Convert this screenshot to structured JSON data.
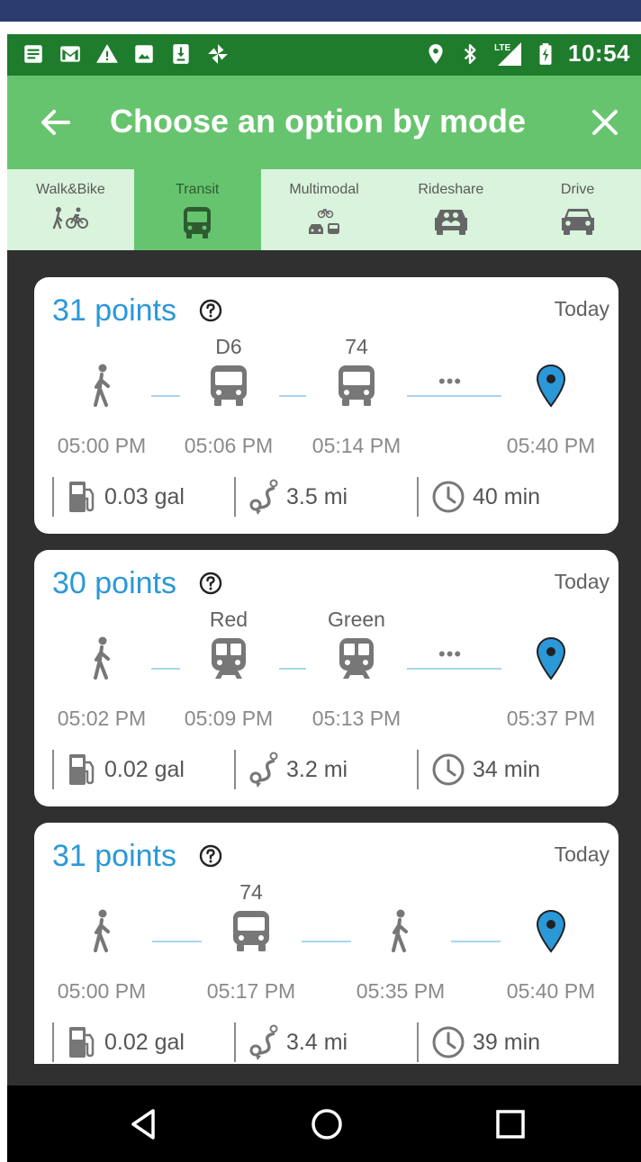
{
  "status_bar": {
    "time": "10:54",
    "left_icons": [
      "notes-icon",
      "gmail-icon",
      "warning-icon",
      "image-icon",
      "download-icon",
      "pinwheel-icon"
    ],
    "right_icons": [
      "location-icon",
      "bluetooth-icon",
      "lte-signal-icon",
      "battery-charging-icon"
    ],
    "lte_label": "LTE"
  },
  "app_bar": {
    "title": "Choose an option by mode",
    "back_icon": "arrow-back-icon",
    "close_icon": "close-icon"
  },
  "mode_tabs": [
    {
      "label": "Walk&Bike",
      "icon": "walk-bike-icon",
      "active": false
    },
    {
      "label": "Transit",
      "icon": "bus-icon",
      "active": true
    },
    {
      "label": "Multimodal",
      "icon": "multimodal-icon",
      "active": false
    },
    {
      "label": "Rideshare",
      "icon": "rideshare-icon",
      "active": false
    },
    {
      "label": "Drive",
      "icon": "car-icon",
      "active": false
    }
  ],
  "options": [
    {
      "points": "31 points",
      "day": "Today",
      "legs": [
        {
          "label": "",
          "icon": "walk-icon",
          "time": "05:00 PM"
        },
        {
          "label": "D6",
          "icon": "bus-icon",
          "time": "05:06 PM"
        },
        {
          "label": "74",
          "icon": "bus-icon",
          "time": "05:14 PM"
        },
        {
          "label": "",
          "icon": "destination-pin-icon",
          "time": "05:40 PM"
        }
      ],
      "more": "•••",
      "fuel": "0.03 gal",
      "distance": "3.5 mi",
      "duration": "40 min"
    },
    {
      "points": "30 points",
      "day": "Today",
      "legs": [
        {
          "label": "",
          "icon": "walk-icon",
          "time": "05:02 PM"
        },
        {
          "label": "Red",
          "icon": "train-icon",
          "time": "05:09 PM"
        },
        {
          "label": "Green",
          "icon": "train-icon",
          "time": "05:13 PM"
        },
        {
          "label": "",
          "icon": "destination-pin-icon",
          "time": "05:37 PM"
        }
      ],
      "more": "•••",
      "fuel": "0.02 gal",
      "distance": "3.2 mi",
      "duration": "34 min"
    },
    {
      "points": "31 points",
      "day": "Today",
      "legs": [
        {
          "label": "",
          "icon": "walk-icon",
          "time": "05:00 PM"
        },
        {
          "label": "74",
          "icon": "bus-icon",
          "time": "05:17 PM"
        },
        {
          "label": "",
          "icon": "walk-icon",
          "time": "05:35 PM"
        },
        {
          "label": "",
          "icon": "destination-pin-icon",
          "time": "05:40 PM"
        }
      ],
      "fuel": "0.02 gal",
      "distance": "3.4 mi",
      "duration": "39 min"
    }
  ],
  "stat_icons": [
    "fuel-pump-icon",
    "route-icon",
    "clock-icon"
  ],
  "nav_bar": [
    "nav-back-icon",
    "nav-home-icon",
    "nav-recents-icon"
  ],
  "colors": {
    "status_bar": "#1f7c2d",
    "app_bar": "#67c46e",
    "tabs_bg": "#d9f3dc",
    "points": "#2b98d8",
    "pin": "#2b98d8",
    "list_bg": "#303030"
  }
}
